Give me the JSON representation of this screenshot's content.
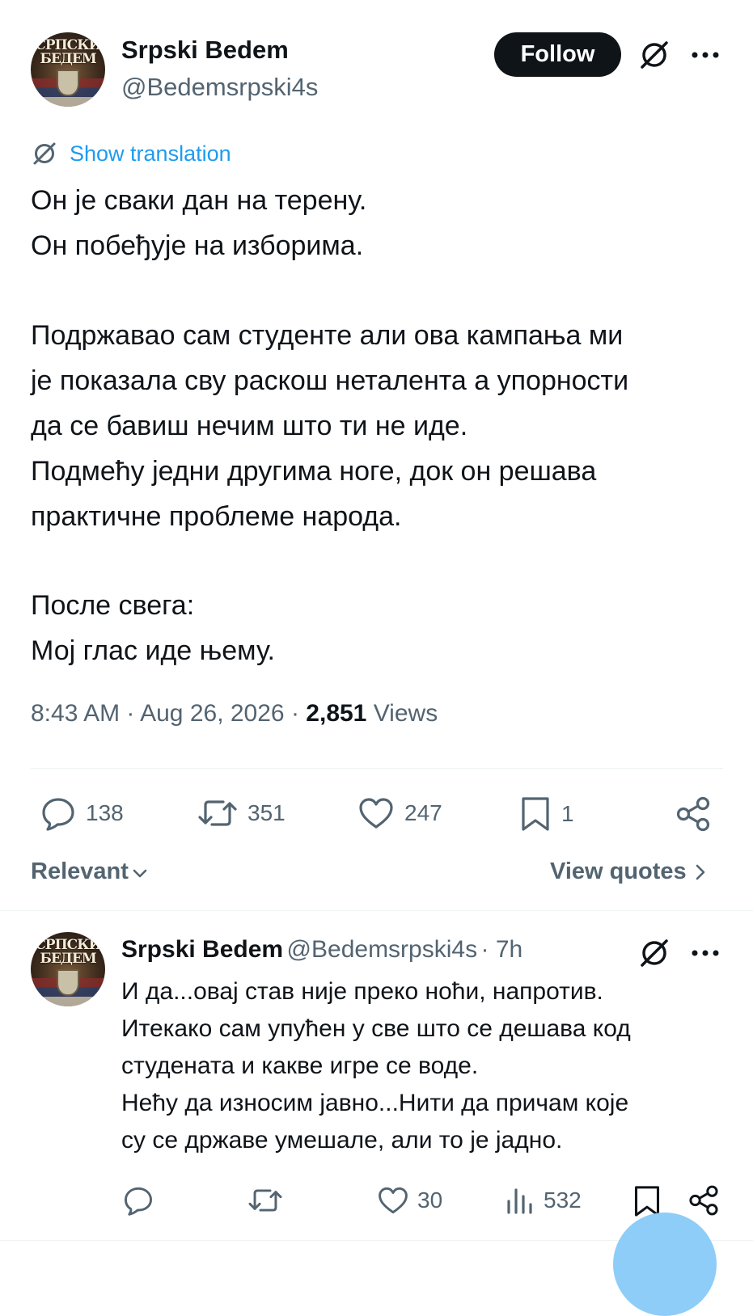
{
  "post": {
    "author_name": "Srpski Bedem",
    "author_handle": "@Bedemsrpski4s",
    "avatar_text_line1": "СРПСКИ",
    "avatar_text_line2": "БЕДЕМ",
    "follow_label": "Follow",
    "show_translation": "Show translation",
    "lines": [
      "Он је сваки дан на терену.",
      "Он побеђује на изборима.",
      "Подржавао сам студенте али ова кампања ми",
      "је показала сву раскош неталента а упорности",
      "да се бавиш нечим што ти не иде.",
      "Подмећу једни другима ноге, док он решава",
      "практичне проблеме народа.",
      "После свега:",
      "Мој глас иде њему."
    ],
    "time": "8:43 AM",
    "date": "Aug 26, 2026",
    "separator": "·",
    "views_count": "2,851",
    "views_label": "Views",
    "actions": {
      "replies": "138",
      "reposts": "351",
      "likes": "247",
      "bookmarks": "1"
    }
  },
  "subbar": {
    "sort_label": "Relevant",
    "view_quotes_label": "View quotes"
  },
  "reply": {
    "author_name": "Srpski Bedem",
    "author_handle": "@Bedemsrpski4s",
    "time_ago": "· 7h",
    "lines": [
      "И да...овај став није преко ноћи, напротив.",
      "Итекако сам упућен у све што се дешава код",
      "студената и какве игре се воде.",
      "Нећу да износим јавно...Нити да причам које",
      "су се државе умешале, али то је јадно."
    ],
    "actions": {
      "replies": "",
      "reposts": "",
      "likes": "30",
      "views": "532"
    }
  },
  "colors": {
    "text": "#0f1419",
    "secondary": "#536471",
    "accent": "#1d9bf0",
    "divider": "#eff3f4"
  },
  "icons": [
    "grok-icon",
    "more-icon",
    "translate-icon",
    "reply-icon",
    "repost-icon",
    "like-icon",
    "bookmark-icon",
    "share-icon",
    "views-icon",
    "chevron-down-icon",
    "chevron-right-icon"
  ]
}
